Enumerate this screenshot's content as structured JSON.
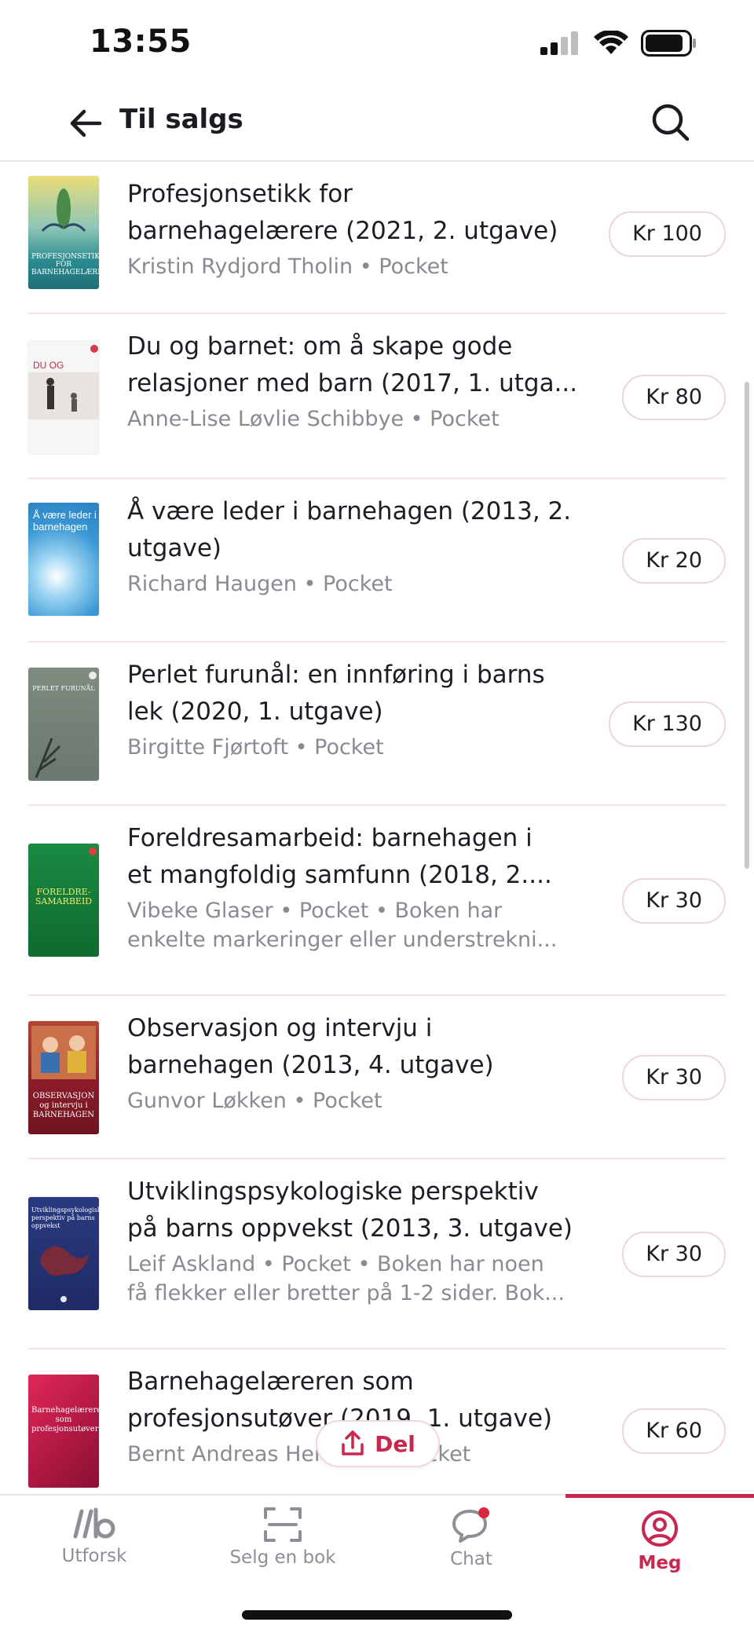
{
  "status": {
    "time": "13:55"
  },
  "header": {
    "title": "Til salgs"
  },
  "books": [
    {
      "title_lines": [
        "Profesjonsetikk for",
        "barnehagelærere (2021, 2. utgave)"
      ],
      "meta_lines": [
        "Kristin Rydjord Tholin • Pocket"
      ],
      "price": "Kr 100",
      "cover_color": "#2a8c8f",
      "cover_text": "PROFESJONSETIKK FOR BARNEHAGELÆRERE"
    },
    {
      "title_lines": [
        "Du og barnet: om å skape gode",
        "relasjoner med barn (2017, 1. utga..."
      ],
      "meta_lines": [
        "Anne-Lise Løvlie Schibbye • Pocket"
      ],
      "price": "Kr 80",
      "cover_color": "#f4f4f4",
      "cover_text": "DU OG BARNET"
    },
    {
      "title_lines": [
        "Å være leder i barnehagen (2013, 2.",
        "utgave)"
      ],
      "meta_lines": [
        "Richard Haugen • Pocket"
      ],
      "price": "Kr 20",
      "cover_color": "#5fb3de",
      "cover_text": "Å være leder i barnehagen"
    },
    {
      "title_lines": [
        "Perlet furunål: en innføring i barns",
        "lek (2020, 1. utgave)"
      ],
      "meta_lines": [
        "Birgitte Fjørtoft • Pocket"
      ],
      "price": "Kr 130",
      "cover_color": "#6f7e72",
      "cover_text": "PERLET FURUNÅL"
    },
    {
      "title_lines": [
        "Foreldresamarbeid: barnehagen i",
        "et mangfoldig samfunn (2018, 2...."
      ],
      "meta_lines": [
        "Vibeke Glaser • Pocket • Boken har",
        "enkelte markeringer eller understrekni..."
      ],
      "price": "Kr 30",
      "cover_color": "#157a3a",
      "cover_text": "FORELDRE-SAMARBEID"
    },
    {
      "title_lines": [
        "Observasjon og intervju i",
        "barnehagen (2013, 4. utgave)"
      ],
      "meta_lines": [
        "Gunvor Løkken • Pocket"
      ],
      "price": "Kr 30",
      "cover_color": "#8b1c2a",
      "cover_text": "OBSERVASJON og intervju i BARNEHAGEN"
    },
    {
      "title_lines": [
        "Utviklingspsykologiske perspektiv",
        "på barns oppvekst (2013, 3. utgave)"
      ],
      "meta_lines": [
        "Leif Askland • Pocket • Boken har noen",
        "få flekker eller bretter på 1-2 sider. Bok..."
      ],
      "price": "Kr 30",
      "cover_color": "#1f2b66",
      "cover_text": "Utviklingspsykologiske perspektiv på barns oppvekst"
    },
    {
      "title_lines": [
        "Barnehagelæreren som",
        "profesjonsutøver (2019, 1. utgave)"
      ],
      "meta_lines": [
        "Bernt Andreas Hennum • Pocket"
      ],
      "price": "Kr 60",
      "cover_color": "#c41d4a",
      "cover_text": "Barnehagelæreren som profesjonsutøver"
    }
  ],
  "share": {
    "label": "Del"
  },
  "tabs": [
    {
      "label": "Utforsk",
      "icon": "logo-icon"
    },
    {
      "label": "Selg en bok",
      "icon": "scan-icon"
    },
    {
      "label": "Chat",
      "icon": "chat-icon"
    },
    {
      "label": "Meg",
      "icon": "profile-icon"
    }
  ],
  "colors": {
    "accent": "#c8274f",
    "muted": "#8e8e96"
  }
}
